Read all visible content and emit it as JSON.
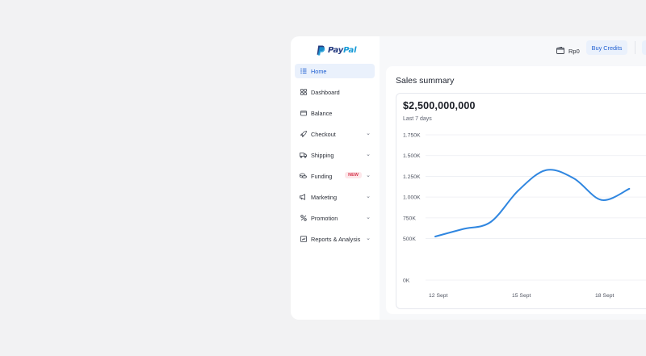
{
  "sidebar": {
    "logo": {
      "part1": "Pay",
      "part2": "Pal"
    },
    "items": [
      {
        "label": "Home",
        "icon": "list-icon",
        "active": true
      },
      {
        "label": "Dashboard",
        "icon": "grid-icon"
      },
      {
        "label": "Balance",
        "icon": "wallet-icon"
      },
      {
        "label": "Checkout",
        "icon": "rocket-icon",
        "chevron": true
      },
      {
        "label": "Shipping",
        "icon": "truck-icon",
        "chevron": true
      },
      {
        "label": "Funding",
        "icon": "coins-icon",
        "chevron": true,
        "badge": "NEW"
      },
      {
        "label": "Marketing",
        "icon": "megaphone-icon",
        "chevron": true
      },
      {
        "label": "Promotion",
        "icon": "percent-icon",
        "chevron": true
      },
      {
        "label": "Reports & Analysis",
        "icon": "report-icon",
        "chevron": true
      }
    ]
  },
  "topbar": {
    "wallet_text": "Rp0",
    "buy_credits": "Buy Credits"
  },
  "card": {
    "title": "Sales summary",
    "amount": "$2,500,000,000",
    "period": "Last 7 days"
  },
  "colors": {
    "accent": "#1f5fd1",
    "line": "#2f86e0",
    "active_bg": "#eaf1fc",
    "badge_text": "#d6394f"
  },
  "chart_data": {
    "type": "line",
    "y_ticks": [
      "1.750K",
      "1.500K",
      "1.250K",
      "1.000K",
      "750K",
      "500K",
      "0K"
    ],
    "y_tick_values": [
      1750,
      1500,
      1250,
      1000,
      750,
      500,
      0
    ],
    "x_ticks": [
      "12 Sept",
      "15 Sept",
      "18 Sept"
    ],
    "x": [
      "12 Sept",
      "13 Sept",
      "14 Sept",
      "15 Sept",
      "16 Sept",
      "17 Sept",
      "18 Sept",
      "19 Sept"
    ],
    "values": [
      525,
      615,
      700,
      1080,
      1325,
      1225,
      965,
      1100
    ],
    "ylim": [
      0,
      1750
    ],
    "grid": true
  }
}
